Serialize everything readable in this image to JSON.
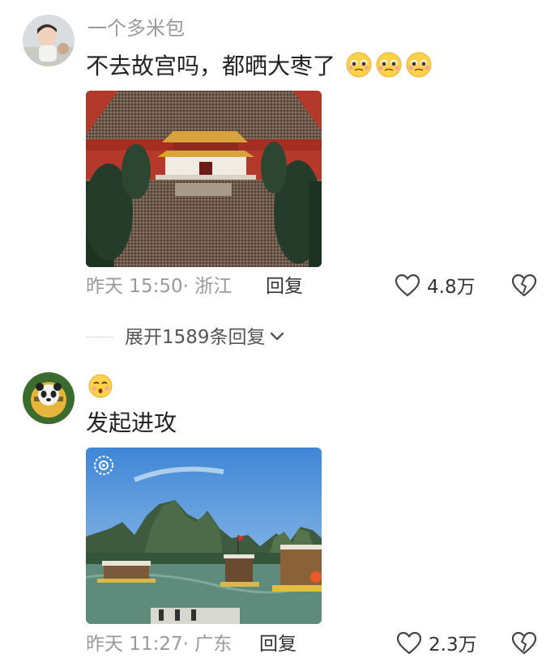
{
  "comments": [
    {
      "username": "一个多米包",
      "text": "不去故宫吗，都晒大枣了",
      "emojis": [
        "pleading-face-emoji",
        "pleading-face-emoji",
        "pleading-face-emoji"
      ],
      "image": "forbidden-city-crowd-photo",
      "time": "昨天 15:50",
      "location": "· 浙江",
      "reply_label": "回复",
      "likes": "4.8万"
    },
    {
      "username": "",
      "username_emoji": "kissing-face-emoji",
      "text": "发起进攻",
      "image": "karst-river-boats-photo",
      "time": "昨天 11:27",
      "location": "· 广东",
      "reply_label": "回复",
      "likes": "2.3万"
    }
  ],
  "expand_replies": {
    "label": "展开1589条回复"
  },
  "colors": {
    "meta_gray": "#9a9a9a",
    "text_dark": "#222222"
  }
}
